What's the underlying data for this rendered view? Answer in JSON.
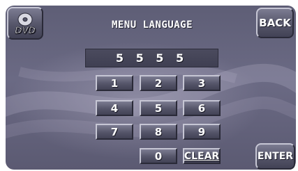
{
  "header": {
    "title": "MENU LANGUAGE",
    "dvd_label": "DVD",
    "back_label": "BACK"
  },
  "display": {
    "value": "5 5 5 5"
  },
  "keypad": {
    "keys": [
      "1",
      "2",
      "3",
      "4",
      "5",
      "6",
      "7",
      "8",
      "9",
      "0"
    ],
    "clear_label": "CLEAR"
  },
  "footer": {
    "enter_label": "ENTER"
  },
  "colors": {
    "panel": "#6b6a84",
    "button": "#555569",
    "display": "#45455a",
    "text": "#ffffff"
  }
}
